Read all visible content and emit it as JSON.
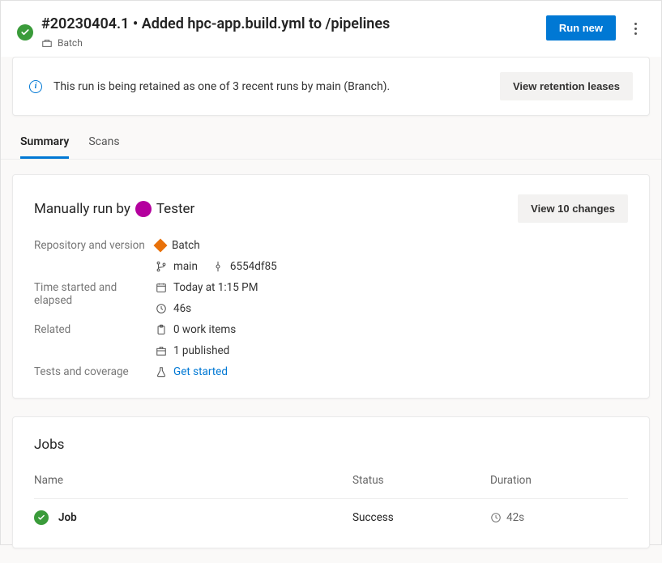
{
  "header": {
    "title": "#20230404.1 • Added hpc-app.build.yml to /pipelines",
    "subtitle": "Batch",
    "run_new": "Run new"
  },
  "banner": {
    "text": "This run is being retained as one of 3 recent runs by main (Branch).",
    "action": "View retention leases"
  },
  "tabs": {
    "summary": "Summary",
    "scans": "Scans"
  },
  "summary": {
    "run_by_prefix": "Manually run by ",
    "run_by_user": "Tester",
    "view_changes": "View 10 changes",
    "labels": {
      "repo": "Repository and version",
      "time": "Time started and elapsed",
      "related": "Related",
      "tests": "Tests and coverage"
    },
    "repo": "Batch",
    "branch": "main",
    "commit": "6554df85",
    "time_started": "Today at 1:15 PM",
    "elapsed": "46s",
    "work_items": "0 work items",
    "published": "1 published",
    "tests_link": "Get started"
  },
  "jobs": {
    "title": "Jobs",
    "columns": {
      "name": "Name",
      "status": "Status",
      "duration": "Duration"
    },
    "rows": [
      {
        "name": "Job",
        "status": "Success",
        "duration": "42s"
      }
    ]
  }
}
